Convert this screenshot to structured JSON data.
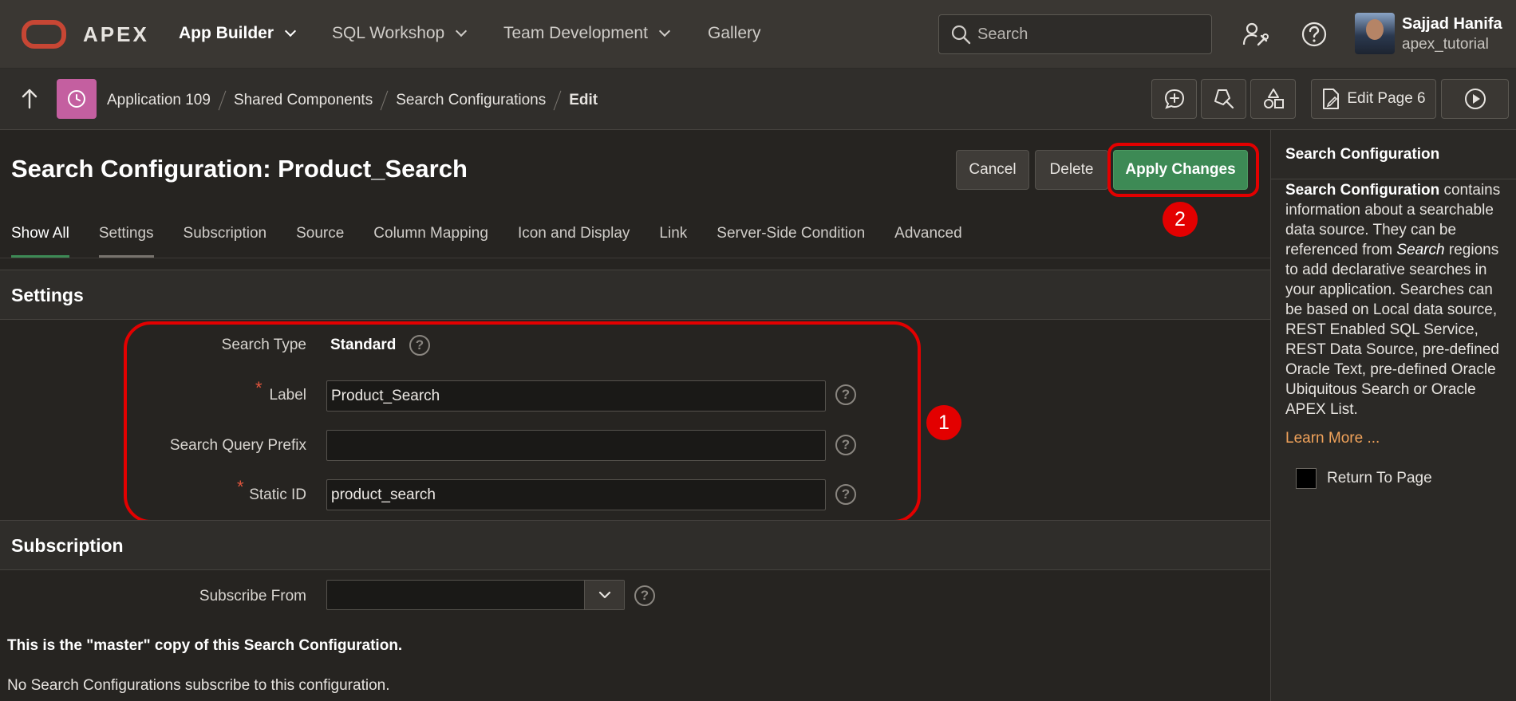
{
  "brand": {
    "name": "APEX",
    "logo_color": "#c74634"
  },
  "topnav": {
    "items": [
      {
        "label": "App Builder",
        "has_dropdown": true,
        "active": true
      },
      {
        "label": "SQL Workshop",
        "has_dropdown": true,
        "active": false
      },
      {
        "label": "Team Development",
        "has_dropdown": true,
        "active": false
      },
      {
        "label": "Gallery",
        "has_dropdown": false,
        "active": false
      }
    ],
    "search_placeholder": "Search",
    "user": {
      "name": "Sajjad Hanifa",
      "workspace": "apex_tutorial"
    },
    "icons": [
      "user-gear-icon",
      "help-icon"
    ]
  },
  "breadcrumb": {
    "items": [
      "Application 109",
      "Shared Components",
      "Search Configurations"
    ],
    "current": "Edit",
    "app_badge_color": "#c45fa0"
  },
  "toolbar": {
    "icons": [
      "add-comment-icon",
      "pin-icon",
      "shapes-icon"
    ],
    "edit_page_label": "Edit Page 6",
    "run_icon": "play-icon"
  },
  "header": {
    "title": "Search Configuration: Product_Search",
    "cancel_label": "Cancel",
    "delete_label": "Delete",
    "apply_label": "Apply Changes"
  },
  "tabs": [
    "Show All",
    "Settings",
    "Subscription",
    "Source",
    "Column Mapping",
    "Icon and Display",
    "Link",
    "Server-Side Condition",
    "Advanced"
  ],
  "settings": {
    "heading": "Settings",
    "search_type_label": "Search Type",
    "search_type_value": "Standard",
    "label_label": "Label",
    "label_value": "Product_Search",
    "prefix_label": "Search Query Prefix",
    "prefix_value": "",
    "static_id_label": "Static ID",
    "static_id_value": "product_search",
    "required_marker": "*"
  },
  "subscription": {
    "heading": "Subscription",
    "subscribe_from_label": "Subscribe From",
    "subscribe_from_value": "",
    "master_note": "This is the \"master\" copy of this Search Configuration.",
    "none_note": "No Search Configurations subscribe to this configuration."
  },
  "callouts": {
    "one": "1",
    "two": "2",
    "color": "#e30000"
  },
  "help_panel": {
    "title": "Search Configuration",
    "body_strong": "Search Configuration",
    "body_1": " contains information about a searchable data source. They can be referenced from ",
    "body_em": "Search",
    "body_2": " regions to add declarative searches in your application. Searches can be based on Local data source, REST Enabled SQL Service, REST Data Source, pre-defined Oracle Text, pre-defined Oracle Ubiquitous Search or Oracle APEX List.",
    "learn_more": "Learn More ...",
    "return_label": "Return To Page"
  },
  "colors": {
    "accent_green": "#3d8a55",
    "link_orange": "#f0a25a"
  }
}
